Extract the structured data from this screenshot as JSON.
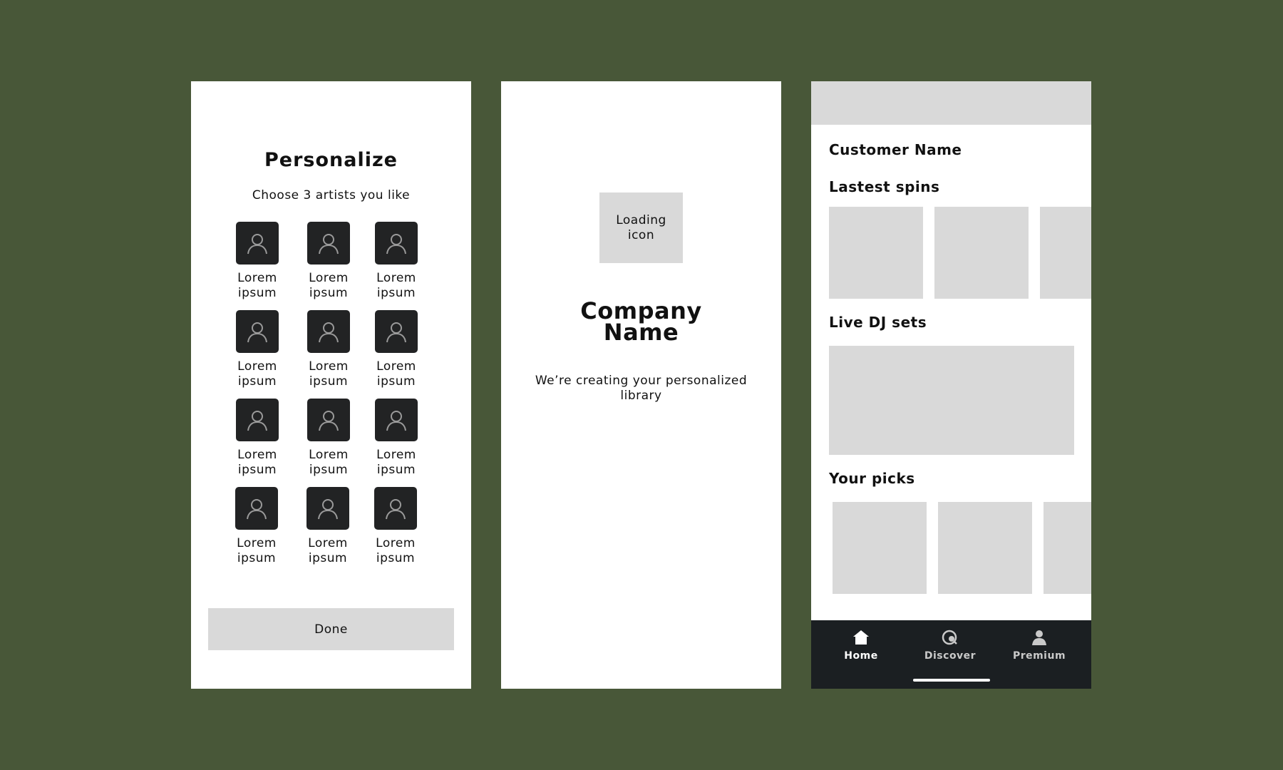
{
  "personalize": {
    "title": "Personalize",
    "subtitle": "Choose 3 artists you like",
    "artists": [
      "Lorem\nipsum",
      "Lorem\nipsum",
      "Lorem\nipsum",
      "Lorem\nipsum",
      "Lorem\nipsum",
      "Lorem\nipsum",
      "Lorem\nipsum",
      "Lorem\nipsum",
      "Lorem\nipsum",
      "Lorem\nipsum",
      "Lorem\nipsum",
      "Lorem\nipsum"
    ],
    "avatar_icon": "user-icon",
    "done_label": "Done"
  },
  "loading": {
    "loading_icon_label": "Loading\nicon",
    "company_name": "Company\nName",
    "message": "We’re creating your personalized library"
  },
  "home": {
    "customer_name": "Customer Name",
    "latest_spins_title": "Lastest spins",
    "live_dj_title": "Live DJ sets",
    "your_picks_title": "Your picks",
    "tabs": [
      {
        "label": "Home",
        "icon": "home-icon"
      },
      {
        "label": "Discover",
        "icon": "discover-icon"
      },
      {
        "label": "Premium",
        "icon": "premium-icon"
      }
    ]
  },
  "colors": {
    "background": "#485738",
    "placeholder": "#d9d9d9",
    "avatar_bg": "#222324",
    "tabbar_bg": "#1b1f22"
  }
}
